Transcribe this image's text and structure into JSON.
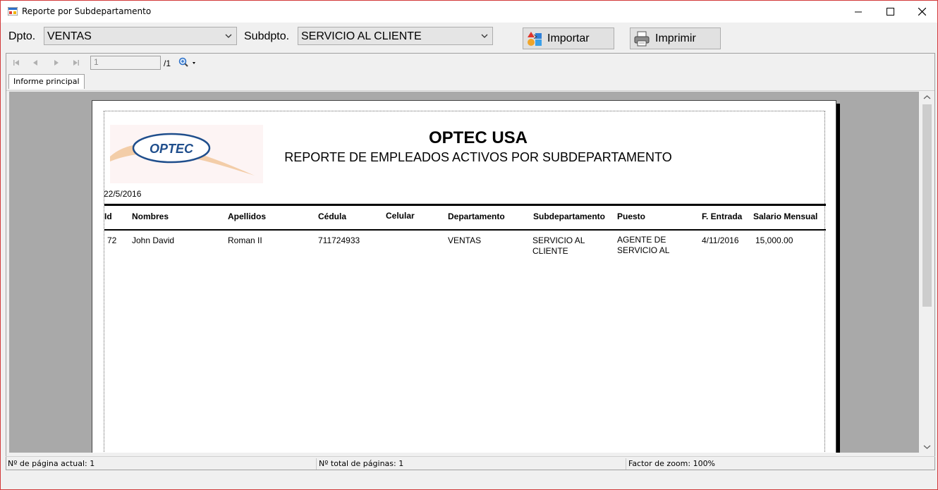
{
  "window": {
    "title": "Reporte por Subdepartamento"
  },
  "filters": {
    "dept_label": "Dpto.",
    "dept_value": "VENTAS",
    "subdept_label": "Subdpto.",
    "subdept_value": "SERVICIO AL CLIENTE"
  },
  "buttons": {
    "import": "Importar",
    "print": "Imprimir"
  },
  "viewer": {
    "current_page": "1",
    "total_pages": "/1",
    "tab": "Informe principal"
  },
  "report": {
    "company": "OPTEC USA",
    "title": "REPORTE DE EMPLEADOS ACTIVOS POR SUBDEPARTAMENTO",
    "date": "22/5/2016",
    "logo_text": "OPTEC",
    "columns": [
      "Id",
      "Nombres",
      "Apellidos",
      "Cédula",
      "Celular",
      "Departamento",
      "Subdepartamento",
      "Puesto",
      "F. Entrada",
      "Salario Mensual"
    ],
    "rows": [
      {
        "id": "72",
        "nombres": "John David",
        "apellidos": "Roman II",
        "cedula": "711724933",
        "celular": "",
        "departamento": "VENTAS",
        "subdepartamento": "SERVICIO AL CLIENTE",
        "puesto": "AGENTE DE SERVICIO AL",
        "f_entrada": "4/11/2016",
        "salario": "15,000.00"
      }
    ]
  },
  "status": {
    "current_page": "Nº de página actual: 1",
    "total_pages": "Nº total de páginas: 1",
    "zoom": "Factor de zoom: 100%"
  },
  "colors": {
    "border": "#d23a3a",
    "logo_blue": "#1f4e8c",
    "logo_swoosh": "#f2c9a0"
  }
}
